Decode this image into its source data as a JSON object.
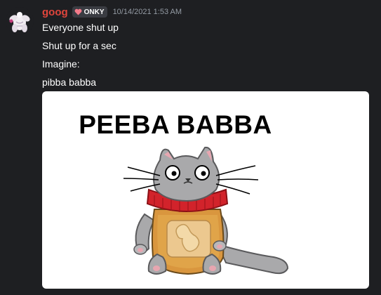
{
  "message": {
    "username": "goog",
    "role_tag": "ONKY",
    "timestamp": "10/14/2021 1:53 AM",
    "lines": [
      "Everyone shut up",
      "Shut up for a sec",
      "Imagine:",
      "pibba babba"
    ]
  },
  "attachment": {
    "meme_text": "PEEBA BABBA"
  },
  "colors": {
    "background": "#1e1f22",
    "username": "#e0453c",
    "role_heart": "#f47b8a",
    "timestamp": "#949ba4",
    "text": "#ffffff"
  }
}
